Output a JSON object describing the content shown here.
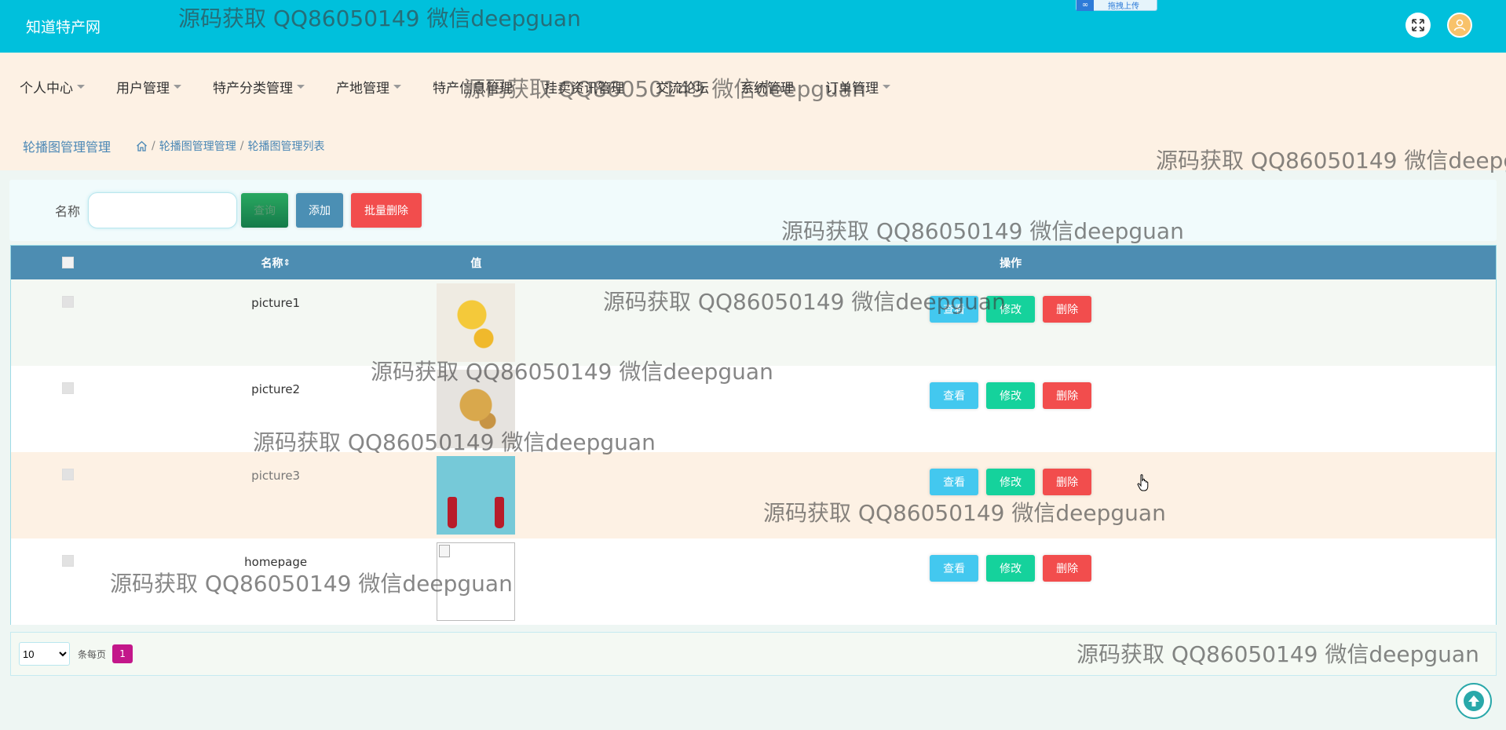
{
  "header": {
    "logo": "知道特产网",
    "upload_badge": "∞",
    "upload_text": "拖拽上传"
  },
  "nav": {
    "items": [
      {
        "label": "个人中心"
      },
      {
        "label": "用户管理"
      },
      {
        "label": "特产分类管理"
      },
      {
        "label": "产地管理"
      },
      {
        "label": "特产信息管理"
      },
      {
        "label": "挂卖资讯管理"
      },
      {
        "label": "交流论坛"
      },
      {
        "label": "系统管理"
      },
      {
        "label": "订单管理"
      }
    ]
  },
  "breadcrumb": {
    "title": "轮播图管理管理",
    "path": [
      "轮播图管理管理",
      "轮播图管理列表"
    ],
    "separator": "/"
  },
  "search": {
    "label": "名称",
    "input_value": "",
    "search_button": "查询",
    "add_button": "添加",
    "bulk_delete_button": "批量删除"
  },
  "table": {
    "headers": {
      "name": "名称",
      "sort_icon": "⇕",
      "value": "值",
      "actions": "操作"
    },
    "rows": [
      {
        "name": "picture1",
        "image": "food-image-1"
      },
      {
        "name": "picture2",
        "image": "food-image-2"
      },
      {
        "name": "picture3",
        "image": "bottles-image"
      },
      {
        "name": "homepage",
        "image": "broken-image"
      }
    ],
    "action_labels": {
      "view": "查看",
      "edit": "修改",
      "delete": "删除"
    }
  },
  "pagination": {
    "page_size": "10",
    "page_size_options": [
      "10"
    ],
    "per_page_label": "条每页",
    "current_page": "1"
  },
  "watermark": "源码获取 QQ86050149 微信deepguan",
  "colors": {
    "header_bg": "#00c0dc",
    "nav_bg": "#fdf1e4",
    "table_header_bg": "#4d8db2",
    "view_btn": "#43c8ef",
    "edit_btn": "#15d29c",
    "delete_btn": "#f24d4d",
    "add_btn": "#4b8fb4",
    "page_active": "#c3178a"
  }
}
